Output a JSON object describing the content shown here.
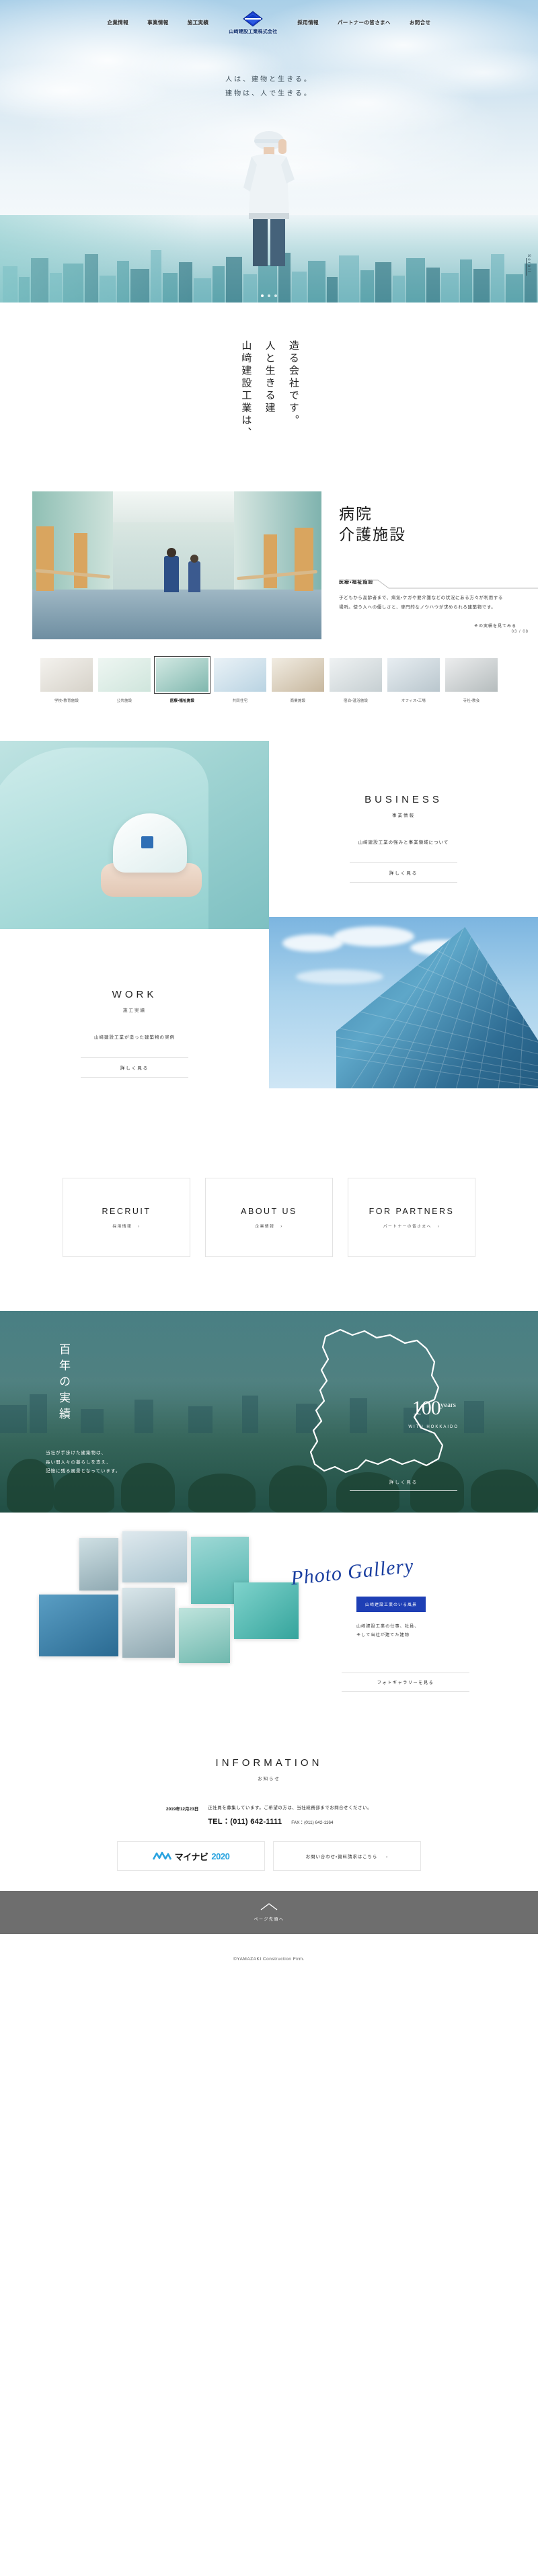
{
  "site": {
    "logo_name": "山﨑建設工業株式会社",
    "logo_icon": "diamond-logo-icon",
    "brand_blue": "#1b3fa0",
    "accent_teal": "#5fb6b2"
  },
  "nav": {
    "left": [
      {
        "label": "企業情報",
        "name": "nav-company"
      },
      {
        "label": "事業情報",
        "name": "nav-business"
      },
      {
        "label": "施工実績",
        "name": "nav-work"
      }
    ],
    "right": [
      {
        "label": "採用情報",
        "name": "nav-recruit"
      },
      {
        "label": "パートナーの皆さまへ",
        "name": "nav-partners"
      },
      {
        "label": "お問合せ",
        "name": "nav-contact"
      }
    ]
  },
  "hero": {
    "line1": "人は、建物と生きる。",
    "line2": "建物は、人で生きる。",
    "scroll_label": "Scroll",
    "slide_count": 3,
    "active_slide": 1
  },
  "statement": {
    "text": "山﨑建設工業は、\n人と生きる建物を\n造る会社です。",
    "col1": "山﨑建設工業は、",
    "col2": "人と生きる建",
    "col3": "造る会社です。"
  },
  "showcase": {
    "title_line1": "病院",
    "title_line2": "介護施設",
    "tag": "医療・福祉施設",
    "description": "子どもから高齢者まで、病気・ケガや要介護などの状況にある方々が利用する場所。使う人への優しさと、専門的なノウハウが求められる建築物です。",
    "more_label": "その実績を見てみる",
    "counter": "03 / 08",
    "thumbs": [
      {
        "label": "学校・教育施設",
        "active": false
      },
      {
        "label": "公共施設",
        "active": false
      },
      {
        "label": "医療・福祉施設",
        "active": true
      },
      {
        "label": "共同住宅",
        "active": false
      },
      {
        "label": "商業施設",
        "active": false
      },
      {
        "label": "宿泊・温浴施設",
        "active": false
      },
      {
        "label": "オフィス・工場",
        "active": false
      },
      {
        "label": "寺社・教会",
        "active": false
      }
    ]
  },
  "business": {
    "en": "BUSINESS",
    "ja": "事業情報",
    "lead": "山﨑建設工業の強みと事業領域について",
    "button": "詳しく見る"
  },
  "work": {
    "en": "WORK",
    "ja": "施工実績",
    "lead": "山﨑建設工業が造った建築物の実例",
    "button": "詳しく見る"
  },
  "cards": [
    {
      "en": "RECRUIT",
      "ja": "採用情報",
      "chev": "›",
      "name": "card-recruit"
    },
    {
      "en": "ABOUT US",
      "ja": "企業情報",
      "chev": "›",
      "name": "card-about-us"
    },
    {
      "en": "FOR PARTNERS",
      "ja": "パートナーの皆さまへ",
      "chev": "›",
      "name": "card-for-partners"
    }
  ],
  "years": {
    "title": "百年の実績",
    "desc_line1": "当社が手掛けた建築物は、",
    "desc_line2": "長い間人々の暮らしを支え、",
    "desc_line3": "記憶に残る風景となっています。",
    "number": "100",
    "number_suffix": "years",
    "subtitle": "WITH HOKKAIDO",
    "button": "詳しく見る"
  },
  "gallery": {
    "script_title": "Photo Gallery",
    "badge": "山﨑建設工業のいる風景",
    "desc_line1": "山﨑建設工業の仕事、社員、",
    "desc_line2": "そして当社が建てた建物",
    "button": "フォトギャラリーを見る"
  },
  "information": {
    "en": "INFORMATION",
    "ja": "お知らせ",
    "date": "2019年12月23日",
    "text": "正社員を募集しています。ご希望の方は、当社総務部までお問合せください。",
    "tel_label": "TEL：",
    "tel": "(011) 642-1111",
    "fax_label": "FAX：",
    "fax": "(011) 642-1164",
    "banner_mynavi_text": "マイナビ",
    "banner_mynavi_year": "2020",
    "banner_contact": "お問い合わせ・資料請求はこちら",
    "banner_contact_chev": "›"
  },
  "footer": {
    "pagetop_arrow": "︿",
    "pagetop_label": "ページ先頭へ",
    "copyright": "©YAMAZAKI Construction Firm."
  }
}
